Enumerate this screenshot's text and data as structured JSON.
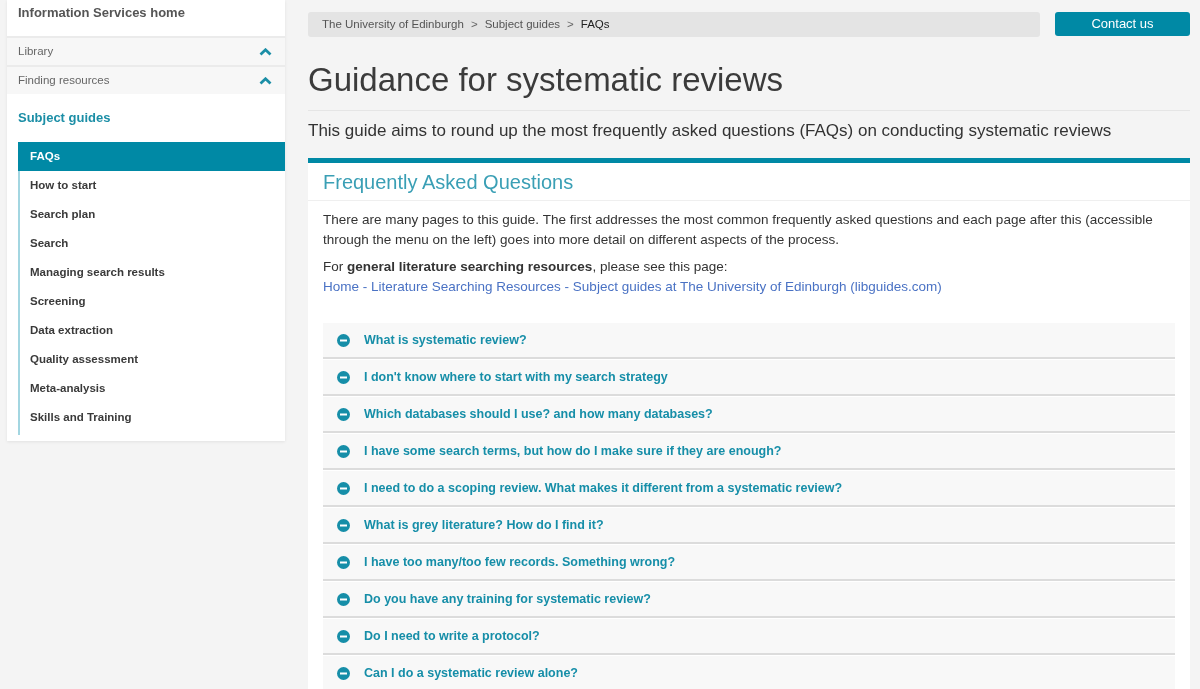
{
  "sidebar": {
    "home_link": "Information Services home",
    "sections": [
      "Library",
      "Finding resources"
    ],
    "guide_title": "Subject guides",
    "items": [
      {
        "label": "FAQs",
        "selected": true
      },
      {
        "label": "How to start",
        "selected": false
      },
      {
        "label": "Search plan",
        "selected": false
      },
      {
        "label": "Search",
        "selected": false
      },
      {
        "label": "Managing search results",
        "selected": false
      },
      {
        "label": "Screening",
        "selected": false
      },
      {
        "label": "Data extraction",
        "selected": false
      },
      {
        "label": "Quality assessment",
        "selected": false
      },
      {
        "label": "Meta-analysis",
        "selected": false
      },
      {
        "label": "Skills and Training",
        "selected": false
      }
    ]
  },
  "breadcrumb": {
    "separator": ">",
    "items": [
      {
        "label": "The University of Edinburgh",
        "current": false
      },
      {
        "label": "Subject guides",
        "current": false
      },
      {
        "label": "FAQs",
        "current": true
      }
    ]
  },
  "contact_button": "Contact us",
  "page_title": "Guidance for systematic reviews",
  "subtitle": "This guide aims to round up the most frequently asked questions (FAQs) on conducting systematic reviews",
  "faq_box": {
    "title": "Frequently Asked Questions",
    "paragraphs": [
      {
        "text": "There are many pages to this guide. The first addresses the most common frequently asked questions and each page after this (accessible through the menu on the left) goes into more detail on different aspects of the process."
      },
      {
        "text": "For **general literature searching resources**, please see this page:",
        "link": "Home - Literature Searching Resources - Subject guides at The University of Edinburgh (libguides.com)"
      }
    ],
    "questions": [
      "What is systematic review?",
      "I don't know where to start with my search strategy",
      "Which databases should I use? and how many databases?",
      "I have some search terms, but how do I make sure if they are enough?",
      "I need to do a scoping review. What makes it different from a systematic review?",
      "What is grey literature? How do I find it?",
      "I have too many/too few records. Something wrong?",
      "Do you have any training for systematic review?",
      "Do I need to write a protocol?",
      "Can I do a systematic review alone?"
    ]
  }
}
